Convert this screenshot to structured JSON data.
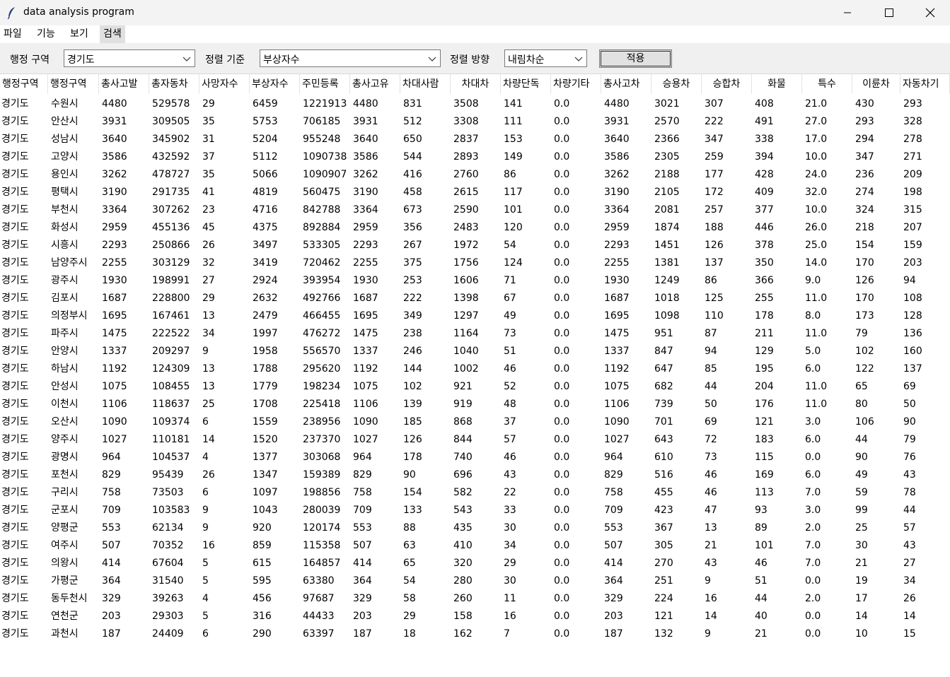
{
  "window": {
    "title": "data analysis program"
  },
  "menu": {
    "items": [
      "파일",
      "기능",
      "보기",
      "검색"
    ]
  },
  "toolbar": {
    "region_label": "행정 구역",
    "region_value": "경기도",
    "sort_label": "정렬 기준",
    "sort_value": "부상자수",
    "direction_label": "정렬 방향",
    "direction_value": "내림차순",
    "apply_label": "적용"
  },
  "table": {
    "columns": [
      "행정구역",
      "행정구역",
      "총사고발",
      "총자동차",
      "사망자수",
      "부상자수",
      "주민등록",
      "총사고유",
      "차대사람",
      "차대차",
      "차량단독",
      "차량기타",
      "총사고차",
      "승용차",
      "승합차",
      "화물",
      "특수",
      "이륜차",
      "자동차기"
    ],
    "rows": [
      [
        "경기도",
        "수원시",
        "4480",
        "529578",
        "29",
        "6459",
        "1221913",
        "4480",
        "831",
        "3508",
        "141",
        "0.0",
        "4480",
        "3021",
        "307",
        "408",
        "21.0",
        "430",
        "293"
      ],
      [
        "경기도",
        "안산시",
        "3931",
        "309505",
        "35",
        "5753",
        "706185",
        "3931",
        "512",
        "3308",
        "111",
        "0.0",
        "3931",
        "2570",
        "222",
        "491",
        "27.0",
        "293",
        "328"
      ],
      [
        "경기도",
        "성남시",
        "3640",
        "345902",
        "31",
        "5204",
        "955248",
        "3640",
        "650",
        "2837",
        "153",
        "0.0",
        "3640",
        "2366",
        "347",
        "338",
        "17.0",
        "294",
        "278"
      ],
      [
        "경기도",
        "고양시",
        "3586",
        "432592",
        "37",
        "5112",
        "1090738",
        "3586",
        "544",
        "2893",
        "149",
        "0.0",
        "3586",
        "2305",
        "259",
        "394",
        "10.0",
        "347",
        "271"
      ],
      [
        "경기도",
        "용인시",
        "3262",
        "478727",
        "35",
        "5066",
        "1090907",
        "3262",
        "416",
        "2760",
        "86",
        "0.0",
        "3262",
        "2188",
        "177",
        "428",
        "24.0",
        "236",
        "209"
      ],
      [
        "경기도",
        "평택시",
        "3190",
        "291735",
        "41",
        "4819",
        "560475",
        "3190",
        "458",
        "2615",
        "117",
        "0.0",
        "3190",
        "2105",
        "172",
        "409",
        "32.0",
        "274",
        "198"
      ],
      [
        "경기도",
        "부천시",
        "3364",
        "307262",
        "23",
        "4716",
        "842788",
        "3364",
        "673",
        "2590",
        "101",
        "0.0",
        "3364",
        "2081",
        "257",
        "377",
        "10.0",
        "324",
        "315"
      ],
      [
        "경기도",
        "화성시",
        "2959",
        "455136",
        "45",
        "4375",
        "892884",
        "2959",
        "356",
        "2483",
        "120",
        "0.0",
        "2959",
        "1874",
        "188",
        "446",
        "26.0",
        "218",
        "207"
      ],
      [
        "경기도",
        "시흥시",
        "2293",
        "250866",
        "26",
        "3497",
        "533305",
        "2293",
        "267",
        "1972",
        "54",
        "0.0",
        "2293",
        "1451",
        "126",
        "378",
        "25.0",
        "154",
        "159"
      ],
      [
        "경기도",
        "남양주시",
        "2255",
        "303129",
        "32",
        "3419",
        "720462",
        "2255",
        "375",
        "1756",
        "124",
        "0.0",
        "2255",
        "1381",
        "137",
        "350",
        "14.0",
        "170",
        "203"
      ],
      [
        "경기도",
        "광주시",
        "1930",
        "198991",
        "27",
        "2924",
        "393954",
        "1930",
        "253",
        "1606",
        "71",
        "0.0",
        "1930",
        "1249",
        "86",
        "366",
        "9.0",
        "126",
        "94"
      ],
      [
        "경기도",
        "김포시",
        "1687",
        "228800",
        "29",
        "2632",
        "492766",
        "1687",
        "222",
        "1398",
        "67",
        "0.0",
        "1687",
        "1018",
        "125",
        "255",
        "11.0",
        "170",
        "108"
      ],
      [
        "경기도",
        "의정부시",
        "1695",
        "167461",
        "13",
        "2479",
        "466455",
        "1695",
        "349",
        "1297",
        "49",
        "0.0",
        "1695",
        "1098",
        "110",
        "178",
        "8.0",
        "173",
        "128"
      ],
      [
        "경기도",
        "파주시",
        "1475",
        "222522",
        "34",
        "1997",
        "476272",
        "1475",
        "238",
        "1164",
        "73",
        "0.0",
        "1475",
        "951",
        "87",
        "211",
        "11.0",
        "79",
        "136"
      ],
      [
        "경기도",
        "안양시",
        "1337",
        "209297",
        "9",
        "1958",
        "556570",
        "1337",
        "246",
        "1040",
        "51",
        "0.0",
        "1337",
        "847",
        "94",
        "129",
        "5.0",
        "102",
        "160"
      ],
      [
        "경기도",
        "하남시",
        "1192",
        "124309",
        "13",
        "1788",
        "295620",
        "1192",
        "144",
        "1002",
        "46",
        "0.0",
        "1192",
        "647",
        "85",
        "195",
        "6.0",
        "122",
        "137"
      ],
      [
        "경기도",
        "안성시",
        "1075",
        "108455",
        "13",
        "1779",
        "198234",
        "1075",
        "102",
        "921",
        "52",
        "0.0",
        "1075",
        "682",
        "44",
        "204",
        "11.0",
        "65",
        "69"
      ],
      [
        "경기도",
        "이천시",
        "1106",
        "118637",
        "25",
        "1708",
        "225418",
        "1106",
        "139",
        "919",
        "48",
        "0.0",
        "1106",
        "739",
        "50",
        "176",
        "11.0",
        "80",
        "50"
      ],
      [
        "경기도",
        "오산시",
        "1090",
        "109374",
        "6",
        "1559",
        "238956",
        "1090",
        "185",
        "868",
        "37",
        "0.0",
        "1090",
        "701",
        "69",
        "121",
        "3.0",
        "106",
        "90"
      ],
      [
        "경기도",
        "양주시",
        "1027",
        "110181",
        "14",
        "1520",
        "237370",
        "1027",
        "126",
        "844",
        "57",
        "0.0",
        "1027",
        "643",
        "72",
        "183",
        "6.0",
        "44",
        "79"
      ],
      [
        "경기도",
        "광명시",
        "964",
        "104537",
        "4",
        "1377",
        "303068",
        "964",
        "178",
        "740",
        "46",
        "0.0",
        "964",
        "610",
        "73",
        "115",
        "0.0",
        "90",
        "76"
      ],
      [
        "경기도",
        "포천시",
        "829",
        "95439",
        "26",
        "1347",
        "159389",
        "829",
        "90",
        "696",
        "43",
        "0.0",
        "829",
        "516",
        "46",
        "169",
        "6.0",
        "49",
        "43"
      ],
      [
        "경기도",
        "구리시",
        "758",
        "73503",
        "6",
        "1097",
        "198856",
        "758",
        "154",
        "582",
        "22",
        "0.0",
        "758",
        "455",
        "46",
        "113",
        "7.0",
        "59",
        "78"
      ],
      [
        "경기도",
        "군포시",
        "709",
        "103583",
        "9",
        "1043",
        "280039",
        "709",
        "133",
        "543",
        "33",
        "0.0",
        "709",
        "423",
        "47",
        "93",
        "3.0",
        "99",
        "44"
      ],
      [
        "경기도",
        "양평군",
        "553",
        "62134",
        "9",
        "920",
        "120174",
        "553",
        "88",
        "435",
        "30",
        "0.0",
        "553",
        "367",
        "13",
        "89",
        "2.0",
        "25",
        "57"
      ],
      [
        "경기도",
        "여주시",
        "507",
        "70352",
        "16",
        "859",
        "115358",
        "507",
        "63",
        "410",
        "34",
        "0.0",
        "507",
        "305",
        "21",
        "101",
        "7.0",
        "30",
        "43"
      ],
      [
        "경기도",
        "의왕시",
        "414",
        "67604",
        "5",
        "615",
        "164857",
        "414",
        "65",
        "320",
        "29",
        "0.0",
        "414",
        "270",
        "43",
        "46",
        "7.0",
        "21",
        "27"
      ],
      [
        "경기도",
        "가평군",
        "364",
        "31540",
        "5",
        "595",
        "63380",
        "364",
        "54",
        "280",
        "30",
        "0.0",
        "364",
        "251",
        "9",
        "51",
        "0.0",
        "19",
        "34"
      ],
      [
        "경기도",
        "동두천시",
        "329",
        "39263",
        "4",
        "456",
        "97687",
        "329",
        "58",
        "260",
        "11",
        "0.0",
        "329",
        "224",
        "16",
        "44",
        "2.0",
        "17",
        "26"
      ],
      [
        "경기도",
        "연천군",
        "203",
        "29303",
        "5",
        "316",
        "44433",
        "203",
        "29",
        "158",
        "16",
        "0.0",
        "203",
        "121",
        "14",
        "40",
        "0.0",
        "14",
        "14"
      ],
      [
        "경기도",
        "과천시",
        "187",
        "24409",
        "6",
        "290",
        "63397",
        "187",
        "18",
        "162",
        "7",
        "0.0",
        "187",
        "132",
        "9",
        "21",
        "0.0",
        "10",
        "15"
      ]
    ]
  }
}
